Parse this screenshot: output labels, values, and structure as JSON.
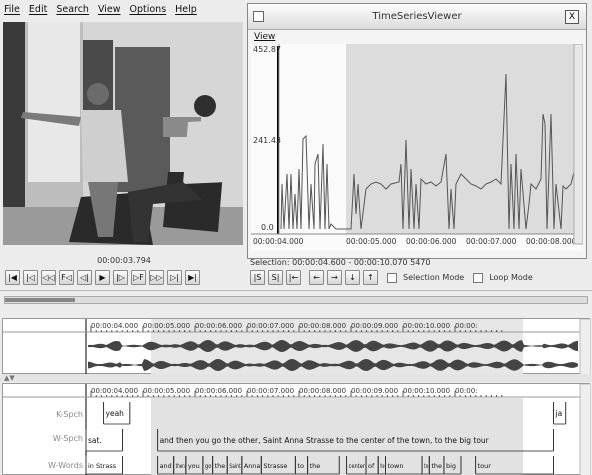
{
  "menu": [
    "File",
    "Edit",
    "Search",
    "View",
    "Options",
    "Help"
  ],
  "video": {
    "timecode": "00:00:03.794"
  },
  "media_controls": [
    "|◀",
    "|◁",
    "◁◁",
    "F◁",
    "◁|",
    "▶",
    "|▷",
    "▷F",
    "▷▷",
    "▷|",
    "▶|"
  ],
  "tsv": {
    "title": "TimeSeriesViewer",
    "view_menu": "View",
    "close_label": "X",
    "y_top": "452.87",
    "y_mid": "241.43",
    "y_bottom": "0.0",
    "x_labels": [
      "00:00:04.000",
      "00:00:05.000",
      "00:00:06.000",
      "00:00:07.000",
      "00:00:08.000"
    ]
  },
  "selection": {
    "label": "Selection: 00:00:04.600 - 00:00:10.070  5470",
    "buttons": [
      "|S",
      "S|",
      "|←",
      "←",
      "→",
      "↓",
      "↑"
    ],
    "selection_mode": "Selection Mode",
    "loop_mode": "Loop Mode"
  },
  "timeline_ticks": [
    "00:00:04.000",
    "00:00:05.000",
    "00:00:06.000",
    "00:00:07.000",
    "00:00:08.000",
    "00:00:09.000",
    "00:00:10.000",
    "00:00:"
  ],
  "tiers": [
    {
      "name": "K-Spch",
      "annotations": [
        {
          "text": "yeah",
          "start": 0.036,
          "end": 0.09
        },
        {
          "text": "ja",
          "start": 0.96,
          "end": 0.985
        }
      ]
    },
    {
      "name": "W-Spch",
      "annotations": [
        {
          "text": "sat.",
          "start": 0.0,
          "end": 0.075
        },
        {
          "text": "and then you go the other, Saint Anna Strasse to the center of the town, to the big tour",
          "start": 0.147,
          "end": 0.96
        }
      ]
    },
    {
      "name": "W-Words",
      "annotations": [
        {
          "text": "in Strass",
          "start": 0.0,
          "end": 0.075
        },
        {
          "text": "and",
          "start": 0.147,
          "end": 0.18
        },
        {
          "text": "then",
          "start": 0.18,
          "end": 0.205
        },
        {
          "text": "you",
          "start": 0.205,
          "end": 0.24
        },
        {
          "text": "go",
          "start": 0.24,
          "end": 0.26
        },
        {
          "text": "the",
          "start": 0.26,
          "end": 0.29
        },
        {
          "text": "Saint",
          "start": 0.29,
          "end": 0.32
        },
        {
          "text": "Anna",
          "start": 0.32,
          "end": 0.36
        },
        {
          "text": "Strasse",
          "start": 0.36,
          "end": 0.43
        },
        {
          "text": "to",
          "start": 0.43,
          "end": 0.455
        },
        {
          "text": "the",
          "start": 0.455,
          "end": 0.52
        },
        {
          "text": "center",
          "start": 0.535,
          "end": 0.575
        },
        {
          "text": "of",
          "start": 0.575,
          "end": 0.6
        },
        {
          "text": "the",
          "start": 0.6,
          "end": 0.615
        },
        {
          "text": "town",
          "start": 0.615,
          "end": 0.69
        },
        {
          "text": "to",
          "start": 0.69,
          "end": 0.705
        },
        {
          "text": "the",
          "start": 0.705,
          "end": 0.735
        },
        {
          "text": "big",
          "start": 0.735,
          "end": 0.77
        },
        {
          "text": "tour",
          "start": 0.8,
          "end": 0.96
        }
      ]
    }
  ],
  "selection_range": {
    "start": 0.147,
    "end": 0.96
  },
  "colors": {
    "selection": "#d9d9d9",
    "plot_bg": "#ffffff",
    "ruler": "#000000"
  }
}
